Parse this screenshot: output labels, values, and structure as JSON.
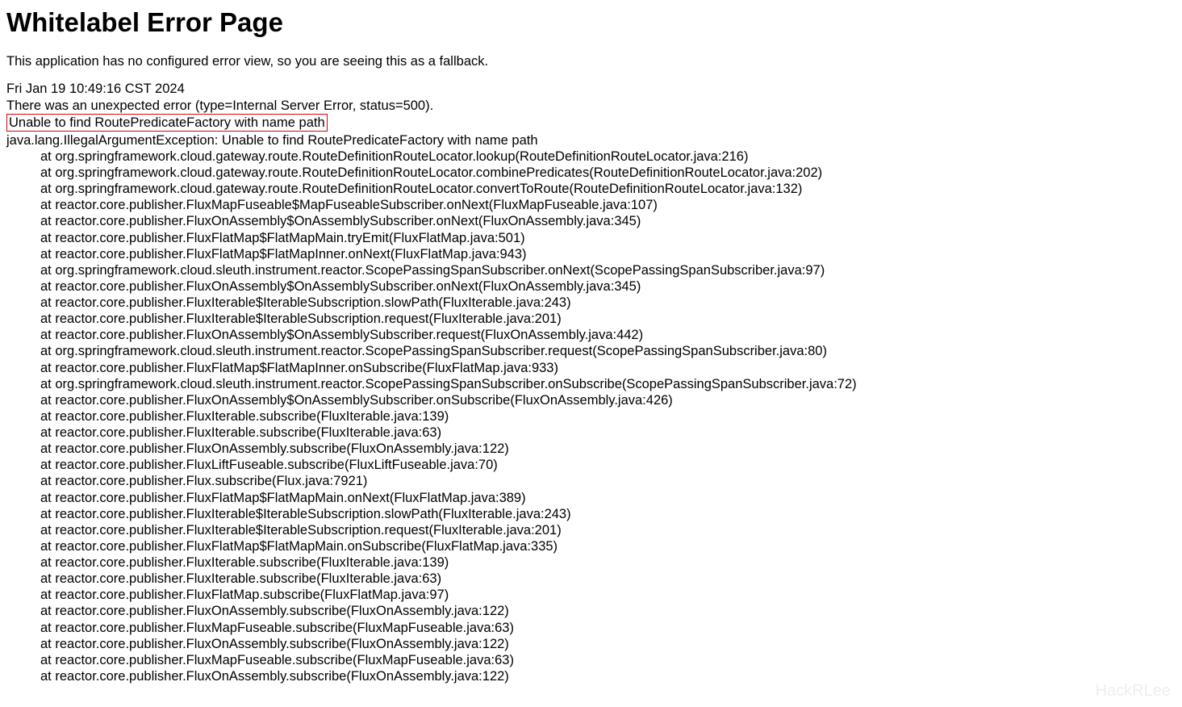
{
  "title": "Whitelabel Error Page",
  "description": "This application has no configured error view, so you are seeing this as a fallback.",
  "timestamp": "Fri Jan 19 10:49:16 CST 2024",
  "error_type": "There was an unexpected error (type=Internal Server Error, status=500).",
  "error_message": "Unable to find RoutePredicateFactory with name path",
  "exception_line": "java.lang.IllegalArgumentException: Unable to find RoutePredicateFactory with name path",
  "stack": [
    "at org.springframework.cloud.gateway.route.RouteDefinitionRouteLocator.lookup(RouteDefinitionRouteLocator.java:216)",
    "at org.springframework.cloud.gateway.route.RouteDefinitionRouteLocator.combinePredicates(RouteDefinitionRouteLocator.java:202)",
    "at org.springframework.cloud.gateway.route.RouteDefinitionRouteLocator.convertToRoute(RouteDefinitionRouteLocator.java:132)",
    "at reactor.core.publisher.FluxMapFuseable$MapFuseableSubscriber.onNext(FluxMapFuseable.java:107)",
    "at reactor.core.publisher.FluxOnAssembly$OnAssemblySubscriber.onNext(FluxOnAssembly.java:345)",
    "at reactor.core.publisher.FluxFlatMap$FlatMapMain.tryEmit(FluxFlatMap.java:501)",
    "at reactor.core.publisher.FluxFlatMap$FlatMapInner.onNext(FluxFlatMap.java:943)",
    "at org.springframework.cloud.sleuth.instrument.reactor.ScopePassingSpanSubscriber.onNext(ScopePassingSpanSubscriber.java:97)",
    "at reactor.core.publisher.FluxOnAssembly$OnAssemblySubscriber.onNext(FluxOnAssembly.java:345)",
    "at reactor.core.publisher.FluxIterable$IterableSubscription.slowPath(FluxIterable.java:243)",
    "at reactor.core.publisher.FluxIterable$IterableSubscription.request(FluxIterable.java:201)",
    "at reactor.core.publisher.FluxOnAssembly$OnAssemblySubscriber.request(FluxOnAssembly.java:442)",
    "at org.springframework.cloud.sleuth.instrument.reactor.ScopePassingSpanSubscriber.request(ScopePassingSpanSubscriber.java:80)",
    "at reactor.core.publisher.FluxFlatMap$FlatMapInner.onSubscribe(FluxFlatMap.java:933)",
    "at org.springframework.cloud.sleuth.instrument.reactor.ScopePassingSpanSubscriber.onSubscribe(ScopePassingSpanSubscriber.java:72)",
    "at reactor.core.publisher.FluxOnAssembly$OnAssemblySubscriber.onSubscribe(FluxOnAssembly.java:426)",
    "at reactor.core.publisher.FluxIterable.subscribe(FluxIterable.java:139)",
    "at reactor.core.publisher.FluxIterable.subscribe(FluxIterable.java:63)",
    "at reactor.core.publisher.FluxOnAssembly.subscribe(FluxOnAssembly.java:122)",
    "at reactor.core.publisher.FluxLiftFuseable.subscribe(FluxLiftFuseable.java:70)",
    "at reactor.core.publisher.Flux.subscribe(Flux.java:7921)",
    "at reactor.core.publisher.FluxFlatMap$FlatMapMain.onNext(FluxFlatMap.java:389)",
    "at reactor.core.publisher.FluxIterable$IterableSubscription.slowPath(FluxIterable.java:243)",
    "at reactor.core.publisher.FluxIterable$IterableSubscription.request(FluxIterable.java:201)",
    "at reactor.core.publisher.FluxFlatMap$FlatMapMain.onSubscribe(FluxFlatMap.java:335)",
    "at reactor.core.publisher.FluxIterable.subscribe(FluxIterable.java:139)",
    "at reactor.core.publisher.FluxIterable.subscribe(FluxIterable.java:63)",
    "at reactor.core.publisher.FluxFlatMap.subscribe(FluxFlatMap.java:97)",
    "at reactor.core.publisher.FluxOnAssembly.subscribe(FluxOnAssembly.java:122)",
    "at reactor.core.publisher.FluxMapFuseable.subscribe(FluxMapFuseable.java:63)",
    "at reactor.core.publisher.FluxOnAssembly.subscribe(FluxOnAssembly.java:122)",
    "at reactor.core.publisher.FluxMapFuseable.subscribe(FluxMapFuseable.java:63)",
    "at reactor.core.publisher.FluxOnAssembly.subscribe(FluxOnAssembly.java:122)"
  ],
  "watermark": "HackRLee"
}
